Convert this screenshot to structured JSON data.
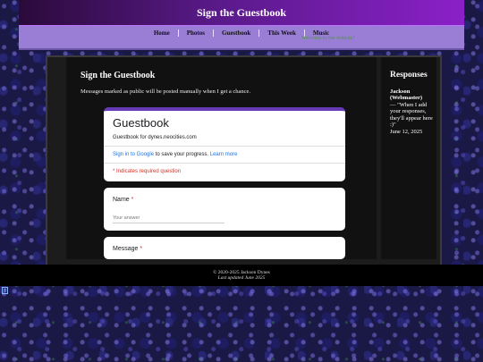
{
  "header": {
    "title": "Sign the Guestbook"
  },
  "nav": {
    "items": [
      "Home",
      "Photos",
      "Guestbook",
      "This Week",
      "Music"
    ],
    "marquee": "Welcome to the website!"
  },
  "main": {
    "heading": "Sign the Guestbook",
    "note": "Messages marked as public will be posted manually when I get a chance."
  },
  "form": {
    "title": "Guestbook",
    "description": "Guestbook for dynes.neocities.com",
    "signin_link": "Sign in to Google",
    "signin_rest": " to save your progress. ",
    "learn_more": "Learn more",
    "required_note": "* Indicates required question",
    "questions": [
      {
        "label": "Name",
        "star": "*",
        "placeholder": "Your answer"
      },
      {
        "label": "Message",
        "star": "*"
      }
    ]
  },
  "sidebar": {
    "heading": "Responses",
    "response": {
      "who": "Jackson (Webmaster)",
      "text": "— \"When I add your responses, they'll appear here :)\"",
      "date": "June 12, 2025"
    }
  },
  "footer": {
    "copyright": "© 2020-2025 Jackson Dynes",
    "updated": "Last updated June 2025"
  },
  "colors": {
    "header_gradient_end": "#8a20c8",
    "nav_bg": "#9a7ed6",
    "form_accent": "#673ab7",
    "required": "#d93025",
    "link": "#1a73e8"
  },
  "icons": {
    "corner": "page-icon"
  }
}
